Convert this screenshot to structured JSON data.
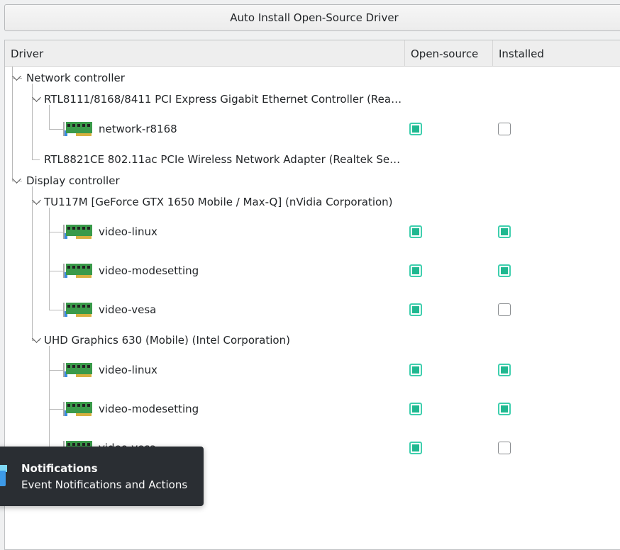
{
  "toolbar": {
    "auto_install_label": "Auto Install Open-Source Driver"
  },
  "columns": {
    "driver": "Driver",
    "open_source": "Open-source",
    "installed": "Installed"
  },
  "rows": [
    {
      "level": 0,
      "label": "Network controller",
      "expanded": true
    },
    {
      "level": 1,
      "label": "RTL8111/8168/8411 PCI Express Gigabit Ethernet Controller (Rea…",
      "expanded": true
    },
    {
      "level": 2,
      "label": "network-r8168",
      "icon": "network-card-icon",
      "open_source": true,
      "installed": false
    },
    {
      "level": 1,
      "label": "RTL8821CE 802.11ac PCIe Wireless Network Adapter (Realtek Se…"
    },
    {
      "level": 0,
      "label": "Display controller",
      "expanded": true
    },
    {
      "level": 1,
      "label": "TU117M [GeForce GTX 1650 Mobile / Max-Q] (nVidia Corporation)",
      "expanded": true
    },
    {
      "level": 2,
      "label": "video-linux",
      "icon": "network-card-icon",
      "open_source": true,
      "installed": true
    },
    {
      "level": 2,
      "label": "video-modesetting",
      "icon": "network-card-icon",
      "open_source": true,
      "installed": true
    },
    {
      "level": 2,
      "label": "video-vesa",
      "icon": "network-card-icon",
      "open_source": true,
      "installed": false
    },
    {
      "level": 1,
      "label": "UHD Graphics 630 (Mobile) (Intel Corporation)",
      "expanded": true
    },
    {
      "level": 2,
      "label": "video-linux",
      "icon": "network-card-icon",
      "open_source": true,
      "installed": true
    },
    {
      "level": 2,
      "label": "video-modesetting",
      "icon": "network-card-icon",
      "open_source": true,
      "installed": true
    },
    {
      "level": 2,
      "label": "video-vesa",
      "icon": "network-card-icon",
      "open_source": true,
      "installed": false
    }
  ],
  "notification": {
    "title": "Notifications",
    "subtitle": "Event Notifications and Actions"
  },
  "colors": {
    "checked": "#1fb890",
    "notification_bg": "#2a2e33"
  }
}
